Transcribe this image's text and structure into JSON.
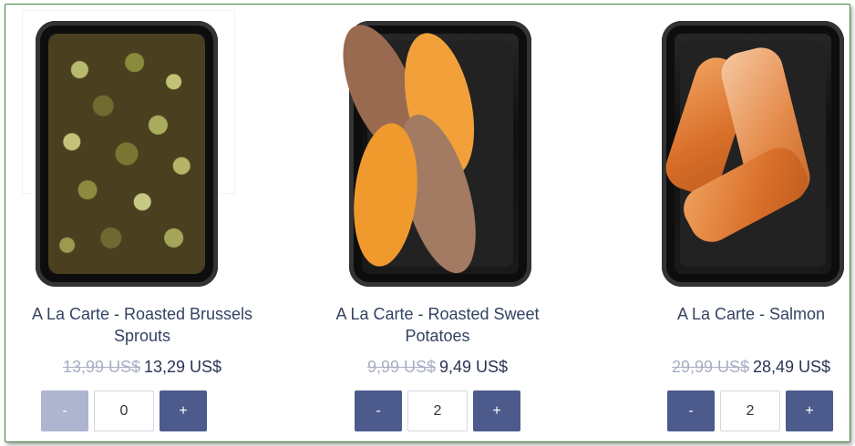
{
  "products": [
    {
      "title_line1": "A La Carte - Roasted Brussels",
      "title_line2": "Sprouts",
      "old_price": "13,99 US$",
      "price": "13,29 US$",
      "minus_label": "-",
      "quantity": "0",
      "plus_label": "+",
      "image": "brussels-sprouts-tray"
    },
    {
      "title_line1": "A La Carte - Roasted Sweet",
      "title_line2": "Potatoes",
      "old_price": "9,99 US$",
      "price": "9,49 US$",
      "minus_label": "-",
      "quantity": "2",
      "plus_label": "+",
      "image": "sweet-potatoes-tray"
    },
    {
      "title_line1": "A La Carte - Salmon",
      "title_line2": "",
      "old_price": "29,99 US$",
      "price": "28,49 US$",
      "minus_label": "-",
      "quantity": "2",
      "plus_label": "+",
      "image": "salmon-tray"
    }
  ],
  "colors": {
    "title": "#344263",
    "button": "#4d5b8c",
    "button_disabled": "#aeb5ce",
    "old_price": "#a8aec4",
    "border": "#3f8a3f"
  }
}
